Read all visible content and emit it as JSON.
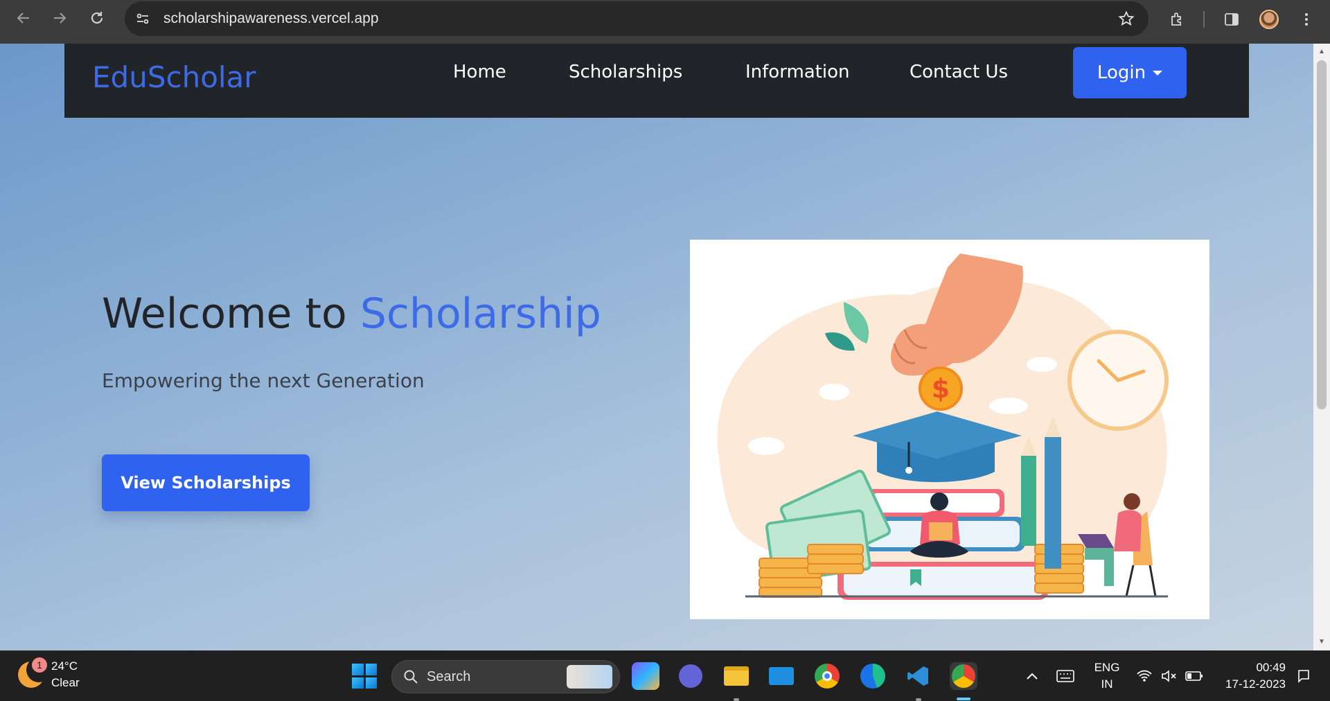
{
  "browser": {
    "url": "scholarshipawareness.vercel.app",
    "icons": [
      "back-arrow-icon",
      "forward-arrow-icon",
      "reload-icon",
      "site-info-icon",
      "bookmark-star-icon",
      "extensions-icon",
      "side-panel-icon",
      "profile-avatar",
      "more-menu-icon"
    ]
  },
  "site": {
    "brand": "EduScholar",
    "nav": {
      "home": "Home",
      "scholarships": "Scholarships",
      "information": "Information",
      "contact": "Contact Us",
      "login": "Login"
    },
    "hero": {
      "title_prefix": "Welcome to",
      "title_accent": "Scholarship",
      "subtitle": "Empowering the next Generation",
      "cta": "View Scholarships"
    },
    "colors": {
      "accent": "#3062f0",
      "brand": "#3d6be8",
      "navbar": "#212529"
    }
  },
  "taskbar": {
    "weather": {
      "temp": "24°C",
      "condition": "Clear",
      "badge": "1"
    },
    "search_label": "Search",
    "language": {
      "line1": "ENG",
      "line2": "IN"
    },
    "time": "00:49",
    "date": "17-12-2023"
  }
}
